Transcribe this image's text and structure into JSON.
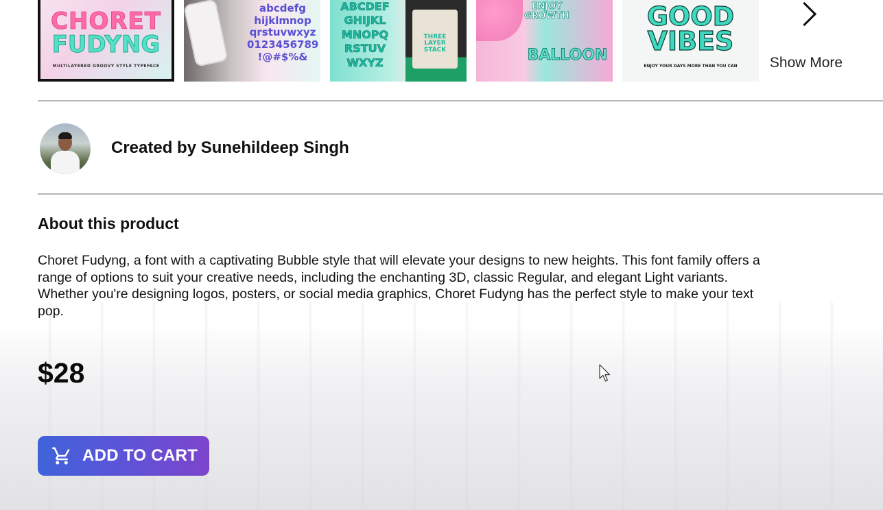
{
  "gallery": {
    "thumbnails": [
      {
        "line1": "CHORET",
        "line2": "FUDYNG",
        "caption": "MULTILAYERED GROOVY STYLE TYPEFACE",
        "selected": true
      },
      {
        "text": "abcdefg hijklmnop qrstuvwxyz 0123456789 !@#$%&"
      },
      {
        "text": "ABCDEF GHIJKL MNOPQ RSTUV WXYZ",
        "bag_text": "THREE LAYER STACK"
      },
      {
        "top_text": "ENJOY GROWTH",
        "main_text": "BALLOON"
      },
      {
        "text": "GOOD VIBES",
        "caption": "ENJOY YOUR DAYS MORE THAN YOU CAN"
      }
    ],
    "show_more_label": "Show More"
  },
  "creator": {
    "label": "Created by Sunehildeep Singh"
  },
  "about": {
    "title": "About this product",
    "description": "Choret Fudyng, a font with a captivating Bubble style that will elevate your designs to new heights. This font family offers a range of options to suit your creative needs, including the enchanting 3D, classic Regular, and elegant Light variants. Whether you're designing logos, posters, or social media graphics, Choret Fudyng has the perfect style to make your text pop."
  },
  "price": "$28",
  "cart": {
    "label": "ADD TO CART",
    "icon": "shopping-cart-icon",
    "gradient_start": "#3f63d9",
    "gradient_end": "#7d45cc"
  }
}
